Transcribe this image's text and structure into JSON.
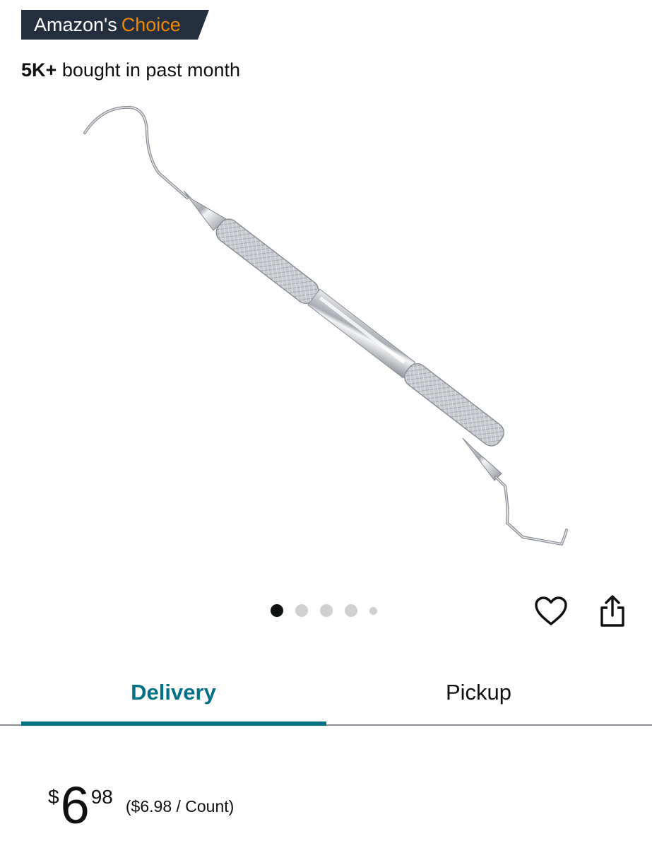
{
  "badge": {
    "prefix": "Amazon's",
    "highlight": "Choice"
  },
  "social_proof": {
    "count": "5K+",
    "text": "bought in past month"
  },
  "image": {
    "description_icon": "dental-scaler-product-image"
  },
  "carousel": {
    "total_dots": 5,
    "active_index": 0
  },
  "actions": {
    "wishlist_icon": "heart-icon",
    "share_icon": "share-icon"
  },
  "tabs": [
    {
      "label": "Delivery",
      "active": true
    },
    {
      "label": "Pickup",
      "active": false
    }
  ],
  "price": {
    "symbol": "$",
    "whole": "6",
    "fraction": "98",
    "unit_price": "($6.98 / Count)"
  },
  "colors": {
    "badge_bg": "#232f3e",
    "badge_accent": "#f08804",
    "tab_accent": "#007185"
  }
}
